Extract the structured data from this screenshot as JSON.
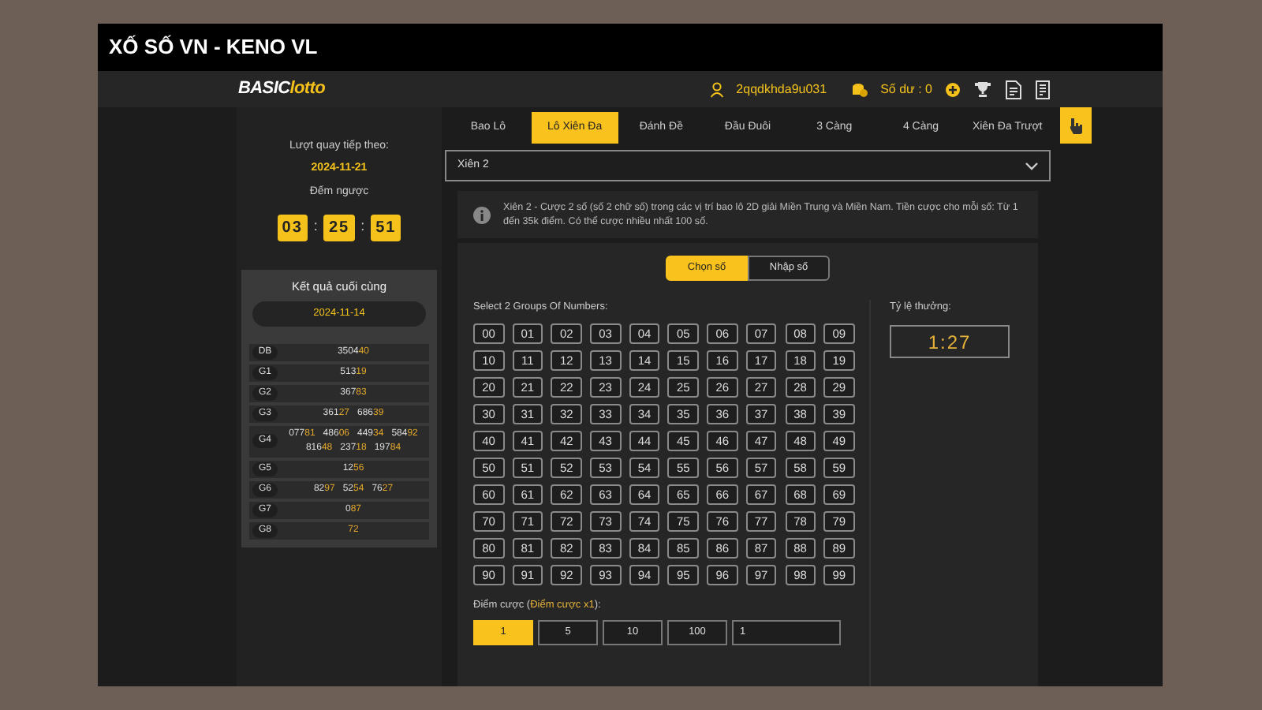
{
  "window": {
    "title": "XỐ SỐ VN - KENO VL"
  },
  "header": {
    "logo": {
      "part_1": "BASIC",
      "part_2": "lotto"
    },
    "username": "2qqdkhda9u031",
    "balance": "Số dư : 0"
  },
  "tabs": [
    {
      "label": "Bao Lô",
      "selected": false
    },
    {
      "label": "Lô Xiên Đa",
      "selected": true
    },
    {
      "label": "Đánh Đề",
      "selected": false
    },
    {
      "label": "Đầu Đuôi",
      "selected": false
    },
    {
      "label": "3 Càng",
      "selected": false
    },
    {
      "label": "4 Càng",
      "selected": false
    },
    {
      "label": "Xiên Đa Trượt",
      "selected": false
    }
  ],
  "sidebar": {
    "next_draw_label": "Lượt quay tiếp theo:",
    "next_draw_date": "2024-11-21",
    "countdown_label": "Đếm ngược",
    "countdown": [
      {
        "kind": "digits",
        "text": "03"
      },
      {
        "kind": "separator",
        "text": ":"
      },
      {
        "kind": "digits",
        "text": "25"
      },
      {
        "kind": "separator",
        "text": ":"
      },
      {
        "kind": "digits",
        "text": "51"
      }
    ],
    "results": {
      "title": "Kết quả cuối cùng",
      "date": "2024-11-14",
      "rows": [
        {
          "label": "DB",
          "numbers": [
            {
              "plain": "3504",
              "highlight": "40"
            }
          ]
        },
        {
          "label": "G1",
          "numbers": [
            {
              "plain": "513",
              "highlight": "19"
            }
          ]
        },
        {
          "label": "G2",
          "numbers": [
            {
              "plain": "367",
              "highlight": "83"
            }
          ]
        },
        {
          "label": "G3",
          "numbers": [
            {
              "plain": "361",
              "highlight": "27"
            },
            {
              "plain": "686",
              "highlight": "39"
            }
          ]
        },
        {
          "label": "G4",
          "numbers": [
            {
              "plain": "077",
              "highlight": "81"
            },
            {
              "plain": "486",
              "highlight": "06"
            },
            {
              "plain": "449",
              "highlight": "34"
            },
            {
              "plain": "584",
              "highlight": "92"
            },
            {
              "plain": "816",
              "highlight": "48"
            },
            {
              "plain": "237",
              "highlight": "18"
            },
            {
              "plain": "197",
              "highlight": "84"
            }
          ]
        },
        {
          "label": "G5",
          "numbers": [
            {
              "plain": "12",
              "highlight": "56"
            }
          ]
        },
        {
          "label": "G6",
          "numbers": [
            {
              "plain": "82",
              "highlight": "97"
            },
            {
              "plain": "52",
              "highlight": "54"
            },
            {
              "plain": "76",
              "highlight": "27"
            }
          ]
        },
        {
          "label": "G7",
          "numbers": [
            {
              "plain": "0",
              "highlight": "87"
            }
          ]
        },
        {
          "label": "G8",
          "numbers": [
            {
              "highlight": "72"
            }
          ]
        }
      ]
    }
  },
  "bet_type": {
    "value": "Xiên 2"
  },
  "info": "Xiên 2 - Cược 2 số (số 2 chữ số) trong các vị trí bao lô 2D giải Miền Trung và Miền Nam. Tiền cược cho mỗi số: Từ 1 đến 35k điểm. Có thể cược nhiều nhất 100 số.",
  "mode_tabs": [
    {
      "label": "Chọn số",
      "selected": true
    },
    {
      "label": "Nhập số",
      "selected": false
    }
  ],
  "numbers_label": "Select 2 Groups Of Numbers:",
  "numbers": [
    {
      "text": "00",
      "selected": false
    },
    {
      "text": "01",
      "selected": false
    },
    {
      "text": "02",
      "selected": false
    },
    {
      "text": "03",
      "selected": false
    },
    {
      "text": "04",
      "selected": false
    },
    {
      "text": "05",
      "selected": false
    },
    {
      "text": "06",
      "selected": false
    },
    {
      "text": "07",
      "selected": false
    },
    {
      "text": "08",
      "selected": false
    },
    {
      "text": "09",
      "selected": false
    },
    {
      "text": "10",
      "selected": false
    },
    {
      "text": "11",
      "selected": false
    },
    {
      "text": "12",
      "selected": false
    },
    {
      "text": "13",
      "selected": false
    },
    {
      "text": "14",
      "selected": false
    },
    {
      "text": "15",
      "selected": false
    },
    {
      "text": "16",
      "selected": false
    },
    {
      "text": "17",
      "selected": false
    },
    {
      "text": "18",
      "selected": false
    },
    {
      "text": "19",
      "selected": false
    },
    {
      "text": "20",
      "selected": false
    },
    {
      "text": "21",
      "selected": false
    },
    {
      "text": "22",
      "selected": false
    },
    {
      "text": "23",
      "selected": false
    },
    {
      "text": "24",
      "selected": false
    },
    {
      "text": "25",
      "selected": false
    },
    {
      "text": "26",
      "selected": false
    },
    {
      "text": "27",
      "selected": false
    },
    {
      "text": "28",
      "selected": false
    },
    {
      "text": "29",
      "selected": false
    },
    {
      "text": "30",
      "selected": false
    },
    {
      "text": "31",
      "selected": false
    },
    {
      "text": "32",
      "selected": false
    },
    {
      "text": "33",
      "selected": false
    },
    {
      "text": "34",
      "selected": false
    },
    {
      "text": "35",
      "selected": false
    },
    {
      "text": "36",
      "selected": false
    },
    {
      "text": "37",
      "selected": false
    },
    {
      "text": "38",
      "selected": false
    },
    {
      "text": "39",
      "selected": false
    },
    {
      "text": "40",
      "selected": false
    },
    {
      "text": "41",
      "selected": false
    },
    {
      "text": "42",
      "selected": false
    },
    {
      "text": "43",
      "selected": false
    },
    {
      "text": "44",
      "selected": false
    },
    {
      "text": "45",
      "selected": false
    },
    {
      "text": "46",
      "selected": false
    },
    {
      "text": "47",
      "selected": false
    },
    {
      "text": "48",
      "selected": false
    },
    {
      "text": "49",
      "selected": false
    },
    {
      "text": "50",
      "selected": false
    },
    {
      "text": "51",
      "selected": false
    },
    {
      "text": "52",
      "selected": false
    },
    {
      "text": "53",
      "selected": false
    },
    {
      "text": "54",
      "selected": false
    },
    {
      "text": "55",
      "selected": false
    },
    {
      "text": "56",
      "selected": false
    },
    {
      "text": "57",
      "selected": false
    },
    {
      "text": "58",
      "selected": false
    },
    {
      "text": "59",
      "selected": false
    },
    {
      "text": "60",
      "selected": false
    },
    {
      "text": "61",
      "selected": false
    },
    {
      "text": "62",
      "selected": false
    },
    {
      "text": "63",
      "selected": false
    },
    {
      "text": "64",
      "selected": false
    },
    {
      "text": "65",
      "selected": false
    },
    {
      "text": "66",
      "selected": false
    },
    {
      "text": "67",
      "selected": false
    },
    {
      "text": "68",
      "selected": false
    },
    {
      "text": "69",
      "selected": false
    },
    {
      "text": "70",
      "selected": false
    },
    {
      "text": "71",
      "selected": false
    },
    {
      "text": "72",
      "selected": false
    },
    {
      "text": "73",
      "selected": false
    },
    {
      "text": "74",
      "selected": false
    },
    {
      "text": "75",
      "selected": false
    },
    {
      "text": "76",
      "selected": false
    },
    {
      "text": "77",
      "selected": false
    },
    {
      "text": "78",
      "selected": false
    },
    {
      "text": "79",
      "selected": false
    },
    {
      "text": "80",
      "selected": false
    },
    {
      "text": "81",
      "selected": false
    },
    {
      "text": "82",
      "selected": false
    },
    {
      "text": "83",
      "selected": false
    },
    {
      "text": "84",
      "selected": false
    },
    {
      "text": "85",
      "selected": false
    },
    {
      "text": "86",
      "selected": false
    },
    {
      "text": "87",
      "selected": false
    },
    {
      "text": "88",
      "selected": false
    },
    {
      "text": "89",
      "selected": false
    },
    {
      "text": "90",
      "selected": false
    },
    {
      "text": "91",
      "selected": false
    },
    {
      "text": "92",
      "selected": false
    },
    {
      "text": "93",
      "selected": false
    },
    {
      "text": "94",
      "selected": false
    },
    {
      "text": "95",
      "selected": false
    },
    {
      "text": "96",
      "selected": false
    },
    {
      "text": "97",
      "selected": false
    },
    {
      "text": "98",
      "selected": false
    },
    {
      "text": "99",
      "selected": false
    }
  ],
  "payout": {
    "label": "Tỷ lệ thưởng:",
    "value": "1:27"
  },
  "bet_points": {
    "label": "Điểm cược (",
    "label_highlight": "Điểm cược x1",
    "label_end": "):",
    "options": [
      {
        "text": "1",
        "selected": true
      },
      {
        "text": "5",
        "selected": false
      },
      {
        "text": "10",
        "selected": false
      },
      {
        "text": "100",
        "selected": false
      }
    ],
    "custom_value": "1"
  }
}
